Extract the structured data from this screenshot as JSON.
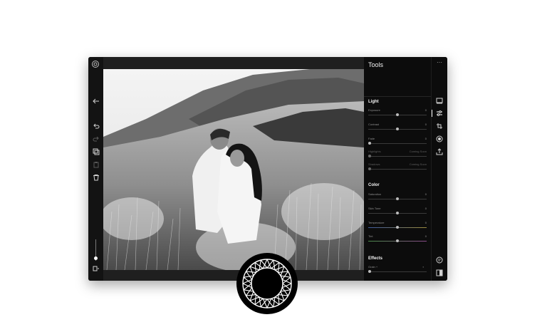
{
  "panel": {
    "title": "Tools",
    "more_icon": "ellipsis-icon",
    "sections": {
      "light": {
        "title": "Light",
        "sliders": [
          {
            "label": "Exposure",
            "value": "0",
            "position": 0.5
          },
          {
            "label": "Contrast",
            "value": "0",
            "position": 0.5
          },
          {
            "label": "Fade",
            "value": "0",
            "position": 0.0
          },
          {
            "label": "Highlights",
            "value": "Coming Soon",
            "position": 0.0
          },
          {
            "label": "Shadows",
            "value": "Coming Soon",
            "position": 0.0
          }
        ]
      },
      "color": {
        "title": "Color",
        "sliders": [
          {
            "label": "Saturation",
            "value": "0",
            "position": 0.5
          },
          {
            "label": "Skin Tone",
            "value": "0",
            "position": 0.5
          },
          {
            "label": "Temperature",
            "value": "0",
            "position": 0.5
          },
          {
            "label": "Tint",
            "value": "0",
            "position": 0.5
          }
        ]
      },
      "effects": {
        "title": "Effects",
        "sliders": [
          {
            "label": "Grain +",
            "value": "",
            "position": 0.0
          }
        ]
      }
    }
  },
  "left_rail": {
    "icons": [
      "settings-icon",
      "back-arrow-icon",
      "undo-icon",
      "redo-icon",
      "copy-icon",
      "paste-icon",
      "delete-icon",
      "compare-icon"
    ],
    "zoom_level": 0.3
  },
  "right_rail": {
    "icons": [
      "preview-icon",
      "adjust-icon",
      "crop-icon",
      "presets-icon",
      "export-icon",
      "history-icon",
      "split-view-icon"
    ]
  },
  "colors": {
    "window_bg": "#1a1a1a",
    "panel_bg": "#0c0c0c",
    "accent": "#ffffff"
  }
}
